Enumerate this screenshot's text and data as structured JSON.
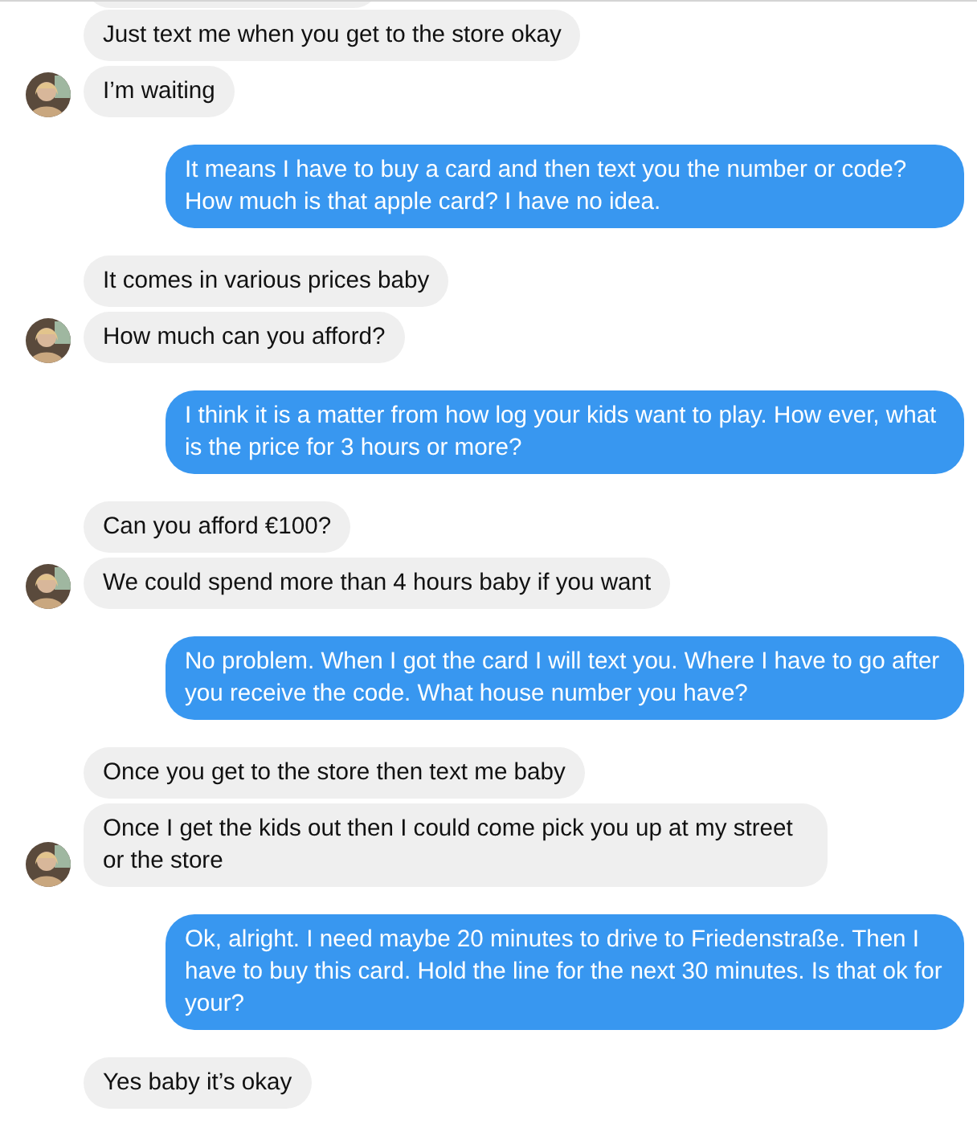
{
  "groups": [
    {
      "kind": "incoming",
      "avatar": true,
      "messages": [
        "Just text me when you get to the store okay",
        "I’m waiting"
      ]
    },
    {
      "kind": "outgoing",
      "messages": [
        "It means I have to buy a card and then text you the number or code? How much is that apple card? I have no idea."
      ]
    },
    {
      "kind": "incoming",
      "avatar": true,
      "messages": [
        "It comes in various prices baby",
        "How much can you afford?"
      ]
    },
    {
      "kind": "outgoing",
      "messages": [
        "I think it is a matter from how log your kids want to play. How ever, what is the price for 3 hours or more?"
      ]
    },
    {
      "kind": "incoming",
      "avatar": true,
      "messages": [
        "Can you afford €100?",
        "We could spend more than 4 hours baby if you want"
      ]
    },
    {
      "kind": "outgoing",
      "messages": [
        "No problem. When I got the card I will text you. Where I have to go after you receive the code. What house number you have?"
      ]
    },
    {
      "kind": "incoming",
      "avatar": true,
      "messages": [
        "Once you get to the store then text me baby",
        "Once I get the kids out then I could come pick you up at my street or the store"
      ]
    },
    {
      "kind": "outgoing",
      "messages": [
        "Ok, alright. I need maybe 20 minutes to drive to Friedenstraße. Then I have to buy this card. Hold the line for the next 30 minutes. Is that ok for your?"
      ]
    },
    {
      "kind": "incoming",
      "avatar": false,
      "messages": [
        "Yes baby it’s okay"
      ]
    }
  ]
}
